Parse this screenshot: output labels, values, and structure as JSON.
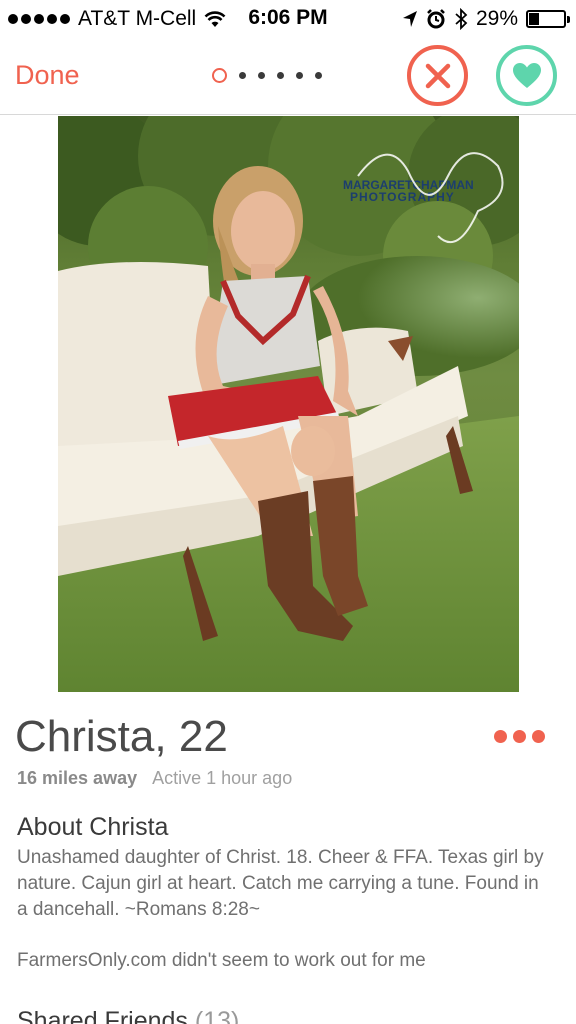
{
  "status_bar": {
    "carrier": "AT&T M-Cell",
    "time": "6:06 PM",
    "battery": "29%",
    "battery_level": 0.29,
    "icons": [
      "signal-dots-icon",
      "wifi-icon",
      "location-arrow-icon",
      "alarm-icon",
      "bluetooth-icon",
      "battery-icon"
    ]
  },
  "nav": {
    "done_label": "Done",
    "photo_count": 6,
    "current_photo": 1,
    "icons": {
      "nope": "x-icon",
      "like": "heart-icon"
    },
    "colors": {
      "accent": "#f0624f",
      "like": "#5ed5ac"
    }
  },
  "photo": {
    "watermark_line1": "MARGARETCHAPMAN",
    "watermark_line2": "PHOTOGRAPHY"
  },
  "profile": {
    "name": "Christa",
    "separator": ",",
    "age": "22",
    "distance": "16 miles away",
    "active": "Active 1 hour ago",
    "about_title": "About Christa",
    "bio": "Unashamed daughter of Christ. 18. Cheer & FFA. Texas girl by nature. Cajun girl at heart. Catch me carrying a tune. Found in a dancehall. ~Romans 8:28~",
    "bio_extra": "FarmersOnly.com didn't seem to work out for me",
    "shared_friends_label": "Shared Friends",
    "shared_friends_count": "(13)"
  }
}
